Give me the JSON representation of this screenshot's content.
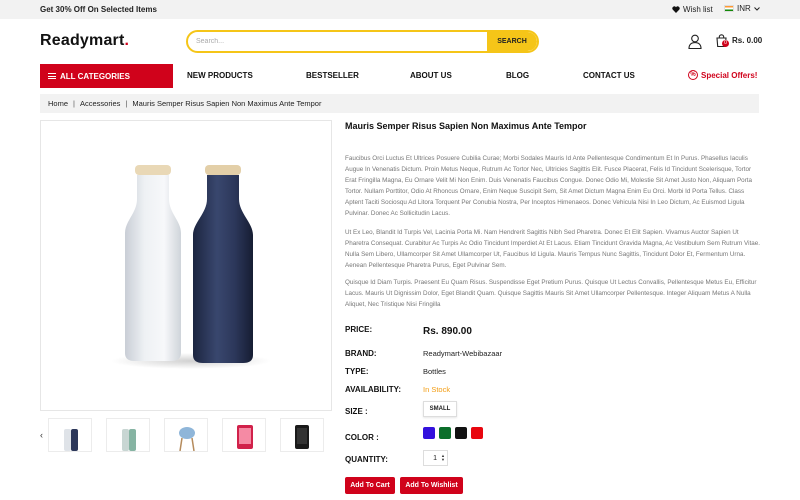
{
  "topbar": {
    "promo": "Get 30% Off On Selected Items",
    "wishlist": "Wish list",
    "currency": "INR"
  },
  "header": {
    "logo": "Readymart",
    "logo_dot": ".",
    "search_placeholder": "Search...",
    "search_button": "SEARCH",
    "cart_count": "0",
    "cart_total": "Rs. 0.00"
  },
  "nav": {
    "all_categories": "ALL CATEGORIES",
    "items": [
      "NEW PRODUCTS",
      "BESTSELLER",
      "ABOUT US",
      "BLOG",
      "CONTACT US"
    ],
    "special": "Special Offers!",
    "special_icon": "%"
  },
  "breadcrumb": [
    "Home",
    "Accessories",
    "Mauris Semper Risus Sapien Non Maximus Ante Tempor"
  ],
  "product": {
    "title": "Mauris Semper Risus Sapien Non Maximus Ante Tempor",
    "desc1": "Faucibus Orci Luctus Et Ultrices Posuere Cubilia Curae; Morbi Sodales Mauris Id Ante Pellentesque Condimentum Et In Purus. Phasellus Iaculis Augue In Venenatis Dictum. Proin Metus Neque, Rutrum Ac Tortor Nec, Ultricies Sagittis Elit. Fusce Placerat, Felis Id Tincidunt Scelerisque, Tortor Erat Fringilla Magna, Eu Ornare Velit Mi Non Enim. Duis Venenatis Faucibus Congue. Donec Odio Mi, Molestie Sit Amet Justo Non, Aliquam Porta Tortor. Nullam Porttitor, Odio At Rhoncus Ornare, Enim Neque Suscipit Sem, Sit Amet Dictum Magna Enim Eu Orci. Morbi Id Porta Tellus. Class Aptent Taciti Sociosqu Ad Litora Torquent Per Conubia Nostra, Per Inceptos Himenaeos. Donec Vehicula Nisi In Leo Dictum, Ac Euismod Ligula Pulvinar. Donec Ac Sollicitudin Lacus.",
    "desc2": "Ut Ex Leo, Blandit Id Turpis Vel, Lacinia Porta Mi. Nam Hendrerit Sagittis Nibh Sed Pharetra. Donec Et Elit Sapien. Vivamus Auctor Sapien Ut Pharetra Consequat. Curabitur Ac Turpis Ac Odio Tincidunt Imperdiet At Et Lacus. Etiam Tincidunt Gravida Magna, Ac Vestibulum Sem Rutrum Vitae. Nulla Sem Libero, Ullamcorper Sit Amet Ullamcorper Ut, Faucibus Id Ligula. Mauris Tempus Nunc Sagittis, Tincidunt Dolor Et, Fermentum Urna. Aenean Pellentesque Pharetra Purus, Eget Pulvinar Sem.",
    "desc3": "Quisque Id Diam Turpis. Praesent Eu Quam Risus. Suspendisse Eget Pretium Purus. Quisque Ut Lectus Convallis, Pellentesque Metus Eu, Efficitur Lacus. Mauris Ut Dignissim Dolor, Eget Blandit Quam. Quisque Sagittis Mauris Sit Amet Ullamcorper Pellentesque. Integer Aliquam Metus A Nulla Aliquet, Nec Tristique Nisi Fringilla",
    "price_label": "PRICE:",
    "price": "Rs. 890.00",
    "brand_label": "BRAND:",
    "brand": "Readymart-Webibazaar",
    "type_label": "TYPE:",
    "type": "Bottles",
    "availability_label": "AVAILABILITY:",
    "availability": "In Stock",
    "size_label": "SIZE :",
    "size": "SMALL",
    "color_label": "COLOR :",
    "colors": [
      "#3311dd",
      "#0b6e2a",
      "#111111",
      "#e8060f"
    ],
    "quantity_label": "QUANTITY:",
    "quantity": "1",
    "add_to_cart": "Add To Cart",
    "add_to_wishlist": "Add To Wishlist"
  },
  "colors": {
    "accent": "#d0021b",
    "search_border": "#f5c518",
    "instock": "#f39c12"
  }
}
